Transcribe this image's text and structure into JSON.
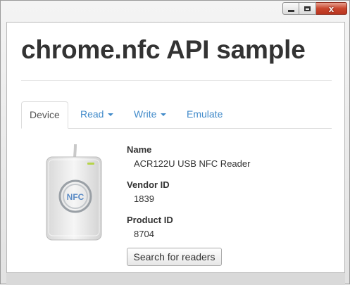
{
  "window": {
    "controls": [
      "minimize-icon",
      "maximize-icon",
      "close-icon"
    ],
    "close_glyph": "x"
  },
  "page": {
    "title": "chrome.nfc API sample"
  },
  "tabs": [
    {
      "label": "Device",
      "active": true,
      "dropdown": false
    },
    {
      "label": "Read",
      "active": false,
      "dropdown": true
    },
    {
      "label": "Write",
      "active": false,
      "dropdown": true
    },
    {
      "label": "Emulate",
      "active": false,
      "dropdown": false
    }
  ],
  "device": {
    "image_icon": "nfc-reader-icon",
    "image_logo_text": "NFC",
    "name_label": "Name",
    "name_value": "ACR122U USB NFC Reader",
    "vendor_label": "Vendor ID",
    "vendor_value": "1839",
    "product_label": "Product ID",
    "product_value": "8704"
  },
  "actions": {
    "search_label": "Search for readers"
  },
  "colors": {
    "link": "#428bca",
    "text": "#333333",
    "close_button": "#c9462d"
  }
}
